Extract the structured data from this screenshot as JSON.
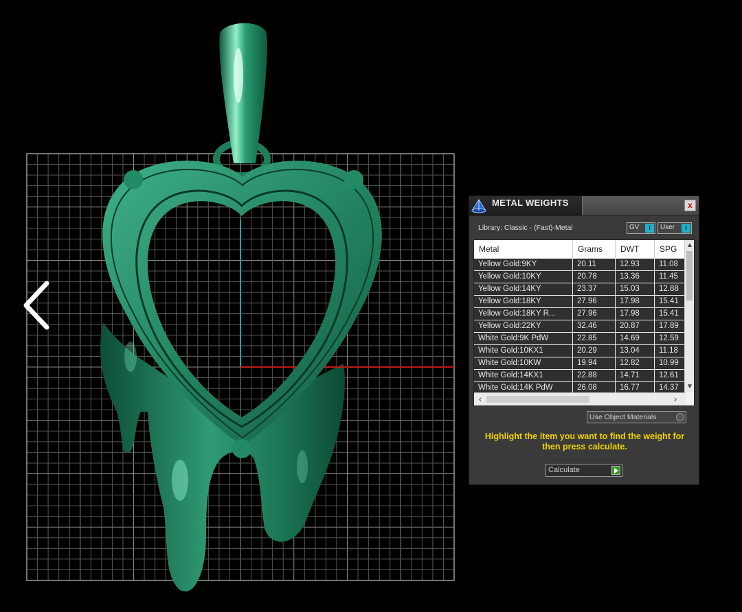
{
  "panel": {
    "title": "METAL WEIGHTS",
    "close_symbol": "x",
    "library_label": "Library: Classic - (Fast)-Metal",
    "toggle_gv": "GV",
    "toggle_user": "User",
    "toggle_indicator": "I",
    "columns": [
      "Metal",
      "Grams",
      "DWT",
      "SPG"
    ],
    "rows": [
      [
        "Yellow Gold:9KY",
        "20.11",
        "12.93",
        "11.08"
      ],
      [
        "Yellow Gold:10KY",
        "20.78",
        "13.36",
        "11.45"
      ],
      [
        "Yellow Gold:14KY",
        "23.37",
        "15.03",
        "12.88"
      ],
      [
        "Yellow Gold:18KY",
        "27.96",
        "17.98",
        "15.41"
      ],
      [
        "Yellow Gold:18KY R...",
        "27.96",
        "17.98",
        "15.41"
      ],
      [
        "Yellow Gold:22KY",
        "32.46",
        "20.87",
        "17.89"
      ],
      [
        "White Gold:9K PdW",
        "22.85",
        "14.69",
        "12.59"
      ],
      [
        "White Gold:10KX1",
        "20.29",
        "13.04",
        "11.18"
      ],
      [
        "White Gold:10KW",
        "19.94",
        "12.82",
        "10.99"
      ],
      [
        "White Gold:14KX1",
        "22.88",
        "14.71",
        "12.61"
      ],
      [
        "White Gold:14K PdW",
        "26.08",
        "16.77",
        "14.37"
      ]
    ],
    "use_object_materials": "Use Object Materials",
    "hint": "Highlight the item you want to find the weight for then press calculate.",
    "calculate": "Calculate"
  },
  "colors": {
    "model_green": "#1e7c5b",
    "hint_yellow": "#f0d400",
    "background": "#000000"
  }
}
